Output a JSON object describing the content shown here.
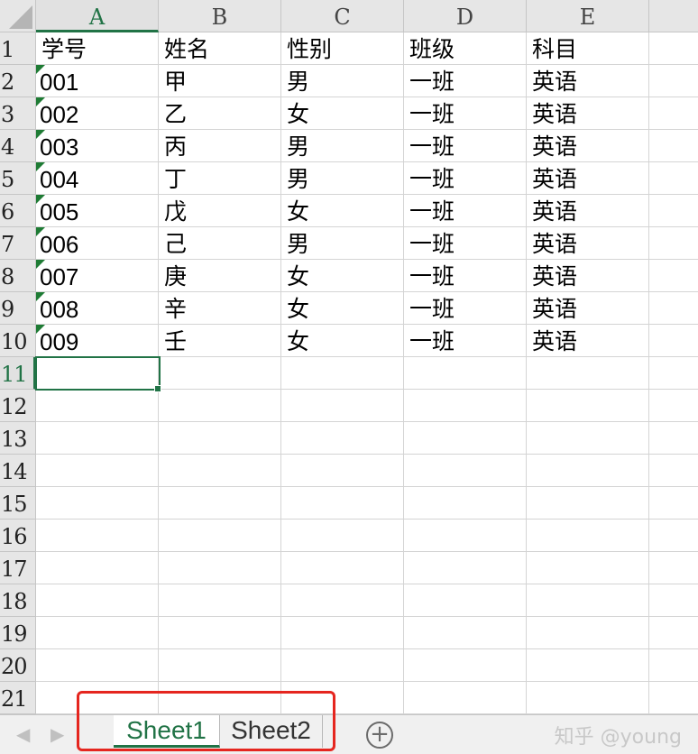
{
  "columns": [
    "A",
    "B",
    "C",
    "D",
    "E"
  ],
  "rows": [
    "1",
    "2",
    "3",
    "4",
    "5",
    "6",
    "7",
    "8",
    "9",
    "10",
    "11",
    "12",
    "13",
    "14",
    "15",
    "16",
    "17",
    "18",
    "19",
    "20",
    "21"
  ],
  "selected_cell": {
    "column": "A",
    "row": "11"
  },
  "table": [
    [
      "学号",
      "姓名",
      "性别",
      "班级",
      "科目"
    ],
    [
      "001",
      "甲",
      "男",
      "一班",
      "英语"
    ],
    [
      "002",
      "乙",
      "女",
      "一班",
      "英语"
    ],
    [
      "003",
      "丙",
      "男",
      "一班",
      "英语"
    ],
    [
      "004",
      "丁",
      "男",
      "一班",
      "英语"
    ],
    [
      "005",
      "戊",
      "女",
      "一班",
      "英语"
    ],
    [
      "006",
      "己",
      "男",
      "一班",
      "英语"
    ],
    [
      "007",
      "庚",
      "女",
      "一班",
      "英语"
    ],
    [
      "008",
      "辛",
      "女",
      "一班",
      "英语"
    ],
    [
      "009",
      "壬",
      "女",
      "一班",
      "英语"
    ]
  ],
  "sheets": [
    {
      "label": "Sheet1",
      "active": true
    },
    {
      "label": "Sheet2",
      "active": false
    }
  ],
  "tabbar": {
    "prev_icon": "chevron-left-icon",
    "next_icon": "chevron-right-icon",
    "add_label": "+",
    "watermark": "知乎 @young"
  },
  "colors": {
    "accent": "#217346",
    "number_flag": "#1e7b34",
    "highlight": "#e5261f"
  }
}
